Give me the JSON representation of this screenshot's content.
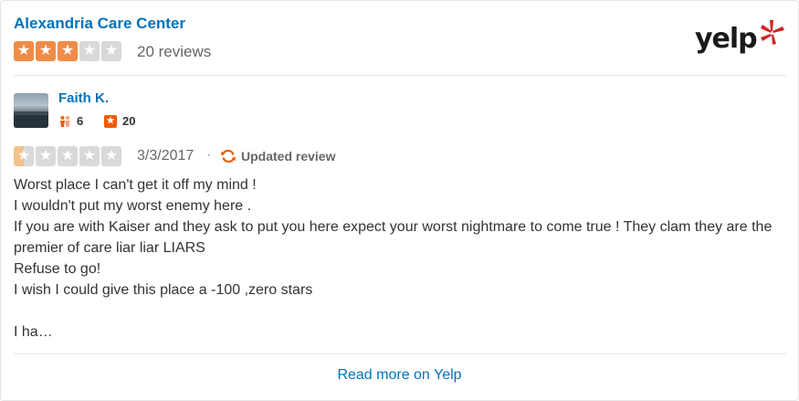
{
  "business": {
    "name": "Alexandria Care Center",
    "rating": 3,
    "review_count_text": "20 reviews"
  },
  "brand": {
    "logo_text": "yelp",
    "color": "#d32323"
  },
  "review": {
    "user": {
      "name": "Faith K.",
      "friends": "6",
      "reviews": "20"
    },
    "rating": 1,
    "date": "3/3/2017",
    "separator": "·",
    "updated_label": "Updated review",
    "lines": [
      "Worst place I can't get it off my mind !",
      "I wouldn't put my worst enemy here .",
      "If you are with Kaiser and they ask to put you here expect your worst nightmare to come true ! They clam they are the premier of care liar liar LIARS",
      "Refuse to go!",
      "I wish I could give this place a -100 ,zero stars",
      "",
      "I ha…"
    ]
  },
  "footer": {
    "read_more": "Read more on Yelp"
  },
  "colors": {
    "link": "#0073bb",
    "star_on": "#f08c47",
    "star_partial": "#f2c28a",
    "star_off": "#d9d9d9",
    "review_badge": "#f15c00"
  },
  "icons": {
    "star": "star-icon",
    "friends": "friends-icon",
    "reviews": "review-count-icon",
    "updated": "refresh-icon"
  }
}
